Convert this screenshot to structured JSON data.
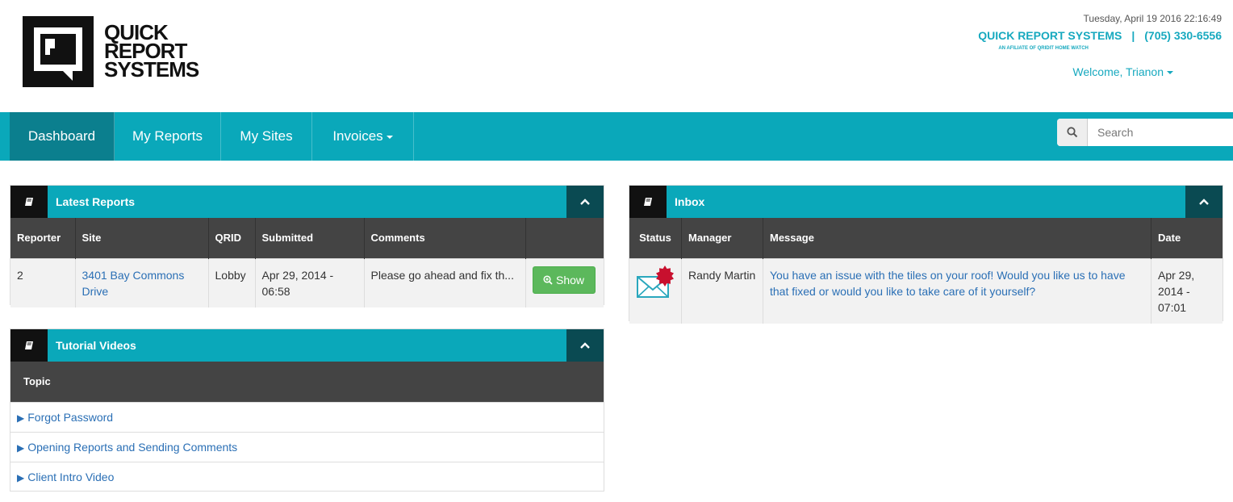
{
  "logo": {
    "line1": "QUICK",
    "line2": "REPORT",
    "line3": "SYSTEMS"
  },
  "header": {
    "datetime": "Tuesday, April 19 2016 22:16:49",
    "company": "QUICK REPORT SYSTEMS",
    "separator": "|",
    "phone": "(705) 330-6556",
    "affiliate": "AN AFILIATE OF QRIDIT HOME WATCH",
    "welcome": "Welcome, Trianon"
  },
  "nav": {
    "items": [
      {
        "label": "Dashboard"
      },
      {
        "label": "My Reports"
      },
      {
        "label": "My Sites"
      },
      {
        "label": "Invoices"
      }
    ],
    "search_placeholder": "Search"
  },
  "latest_reports": {
    "title": "Latest Reports",
    "columns": [
      "Reporter",
      "Site",
      "QRID",
      "Submitted",
      "Comments",
      ""
    ],
    "rows": [
      {
        "reporter": "2",
        "site": "3401 Bay Commons Drive",
        "qrid": "Lobby",
        "submitted": "Apr 29, 2014 - 06:58",
        "comments": "Please go ahead and fix th...",
        "action": "Show"
      }
    ]
  },
  "tutorials": {
    "title": "Tutorial Videos",
    "column": "Topic",
    "items": [
      {
        "label": "Forgot Password"
      },
      {
        "label": "Opening Reports and Sending Comments"
      },
      {
        "label": "Client Intro Video"
      }
    ]
  },
  "inbox": {
    "title": "Inbox",
    "columns": [
      "Status",
      "Manager",
      "Message",
      "Date"
    ],
    "rows": [
      {
        "status_icon": "envelope-unread-icon",
        "manager": "Randy Martin",
        "message": "You have an issue with the tiles on your roof! Would you like us to have that fixed or would you like to take care of it yourself?",
        "date": "Apr 29, 2014 - 07:01"
      }
    ]
  },
  "colors": {
    "brand": "#0aa8ba",
    "nav_active": "#0b7f8e",
    "toggle": "#0a4a52",
    "table_header": "#444444",
    "link": "#2a6fb5",
    "show_button": "#5cb85c"
  }
}
